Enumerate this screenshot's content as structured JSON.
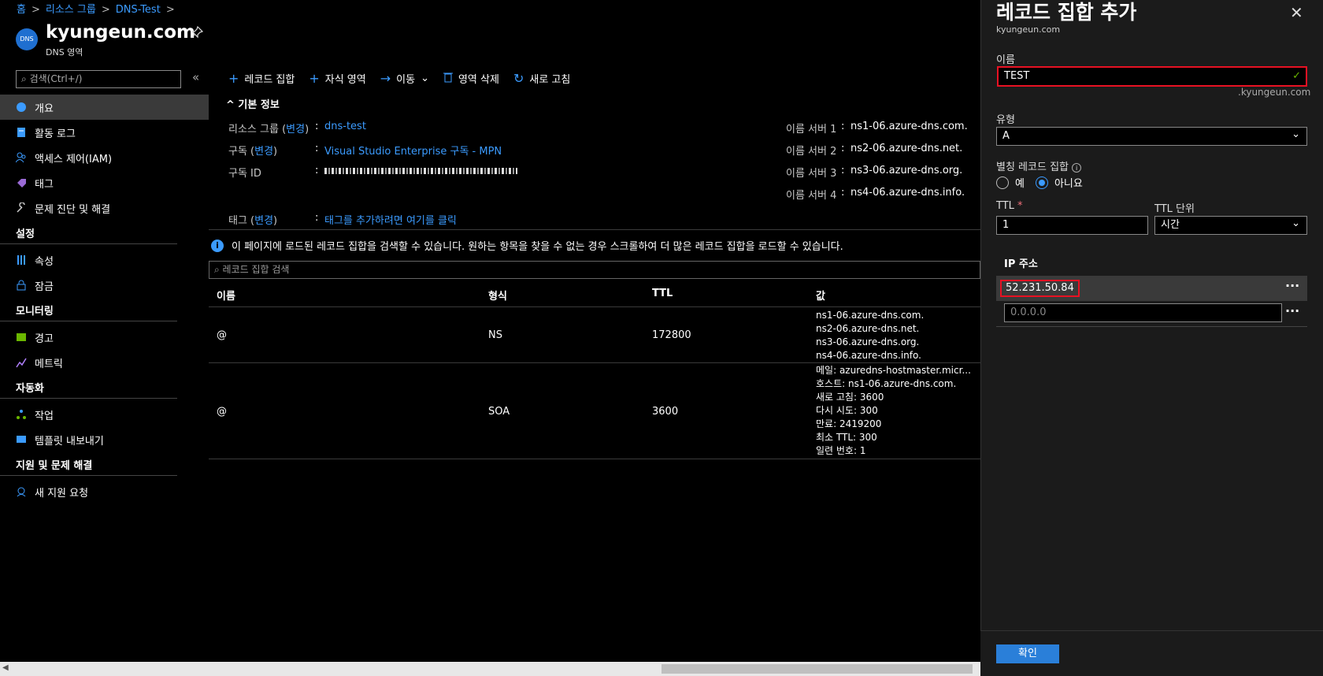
{
  "breadcrumb": {
    "home": "홈",
    "group": "리소스 그룹",
    "item": "DNS-Test"
  },
  "resource": {
    "icon_text": "DNS",
    "title": "kyungeun.com",
    "subtitle": "DNS 영역"
  },
  "sidebar": {
    "search_placeholder": "검색(Ctrl+/)",
    "collapse": "«",
    "top_items": [
      "개요",
      "활동 로그",
      "액세스 제어(IAM)",
      "태그",
      "문제 진단 및 해결"
    ],
    "sections": [
      {
        "title": "설정",
        "items": [
          "속성",
          "잠금"
        ]
      },
      {
        "title": "모니터링",
        "items": [
          "경고",
          "메트릭"
        ]
      },
      {
        "title": "자동화",
        "items": [
          "작업",
          "템플릿 내보내기"
        ]
      },
      {
        "title": "지원 및 문제 해결",
        "items": [
          "새 지원 요청"
        ]
      }
    ]
  },
  "toolbar": {
    "add_recordset": "레코드 집합",
    "child_zone": "자식 영역",
    "move": "이동",
    "delete_zone": "영역 삭제",
    "refresh": "새로 고침"
  },
  "essentials": {
    "header": "기본 정보",
    "rg_label": "리소스 그룹 (",
    "change": "변경",
    "rg_label_end": ")",
    "rg_value": "dns-test",
    "sub_label": "구독 (",
    "sub_label_end": ")",
    "sub_value": "Visual Studio Enterprise 구독 - MPN",
    "subid_label": "구독 ID",
    "ns1_label": "이름 서버 1",
    "ns1": "ns1-06.azure-dns.com.",
    "ns2_label": "이름 서버 2",
    "ns2": "ns2-06.azure-dns.net.",
    "ns3_label": "이름 서버 3",
    "ns3": "ns3-06.azure-dns.org.",
    "ns4_label": "이름 서버 4",
    "ns4": "ns4-06.azure-dns.info.",
    "tag_label": "태그 (",
    "tag_label_end": ")",
    "tag_value": "태그를 추가하려면 여기를 클릭",
    "colon": ":"
  },
  "info_message": "이 페이지에 로드된 레코드 집합을 검색할 수 있습니다. 원하는 항목을 찾을 수 없는 경우 스크롤하여 더 많은 레코드 집합을 로드할 수 있습니다.",
  "record_search_placeholder": "레코드 집합 검색",
  "table": {
    "headers": {
      "name": "이름",
      "type": "형식",
      "ttl": "TTL",
      "value": "값"
    },
    "rows": [
      {
        "name": "@",
        "type": "NS",
        "ttl": "172800",
        "values": [
          "ns1-06.azure-dns.com.",
          "ns2-06.azure-dns.net.",
          "ns3-06.azure-dns.org.",
          "ns4-06.azure-dns.info."
        ]
      },
      {
        "name": "@",
        "type": "SOA",
        "ttl": "3600",
        "values": [
          "메일: azuredns-hostmaster.micr...",
          "호스트: ns1-06.azure-dns.com.",
          "새로 고침: 3600",
          "다시 시도: 300",
          "만료: 2419200",
          "최소 TTL: 300",
          "일련 번호: 1"
        ]
      }
    ]
  },
  "panel": {
    "title": "레코드 집합 추가",
    "subtitle": "kyungeun.com",
    "name_label": "이름",
    "name_value": "TEST",
    "name_suffix": ".kyungeun.com",
    "type_label": "유형",
    "type_value": "A",
    "alias_label": "별칭 레코드 집합",
    "alias_yes": "예",
    "alias_no": "아니요",
    "ttl_label": "TTL",
    "ttl_required": "*",
    "ttl_value": "1",
    "ttl_unit_label": "TTL 단위",
    "ttl_unit_value": "시간",
    "ip_header": "IP 주소",
    "ip_value": "52.231.50.84",
    "ip_placeholder": "0.0.0.0",
    "ok": "확인"
  },
  "colors": {
    "accent": "#3b9bff",
    "highlight": "#e81123",
    "primary_button": "#2a7fd9"
  }
}
